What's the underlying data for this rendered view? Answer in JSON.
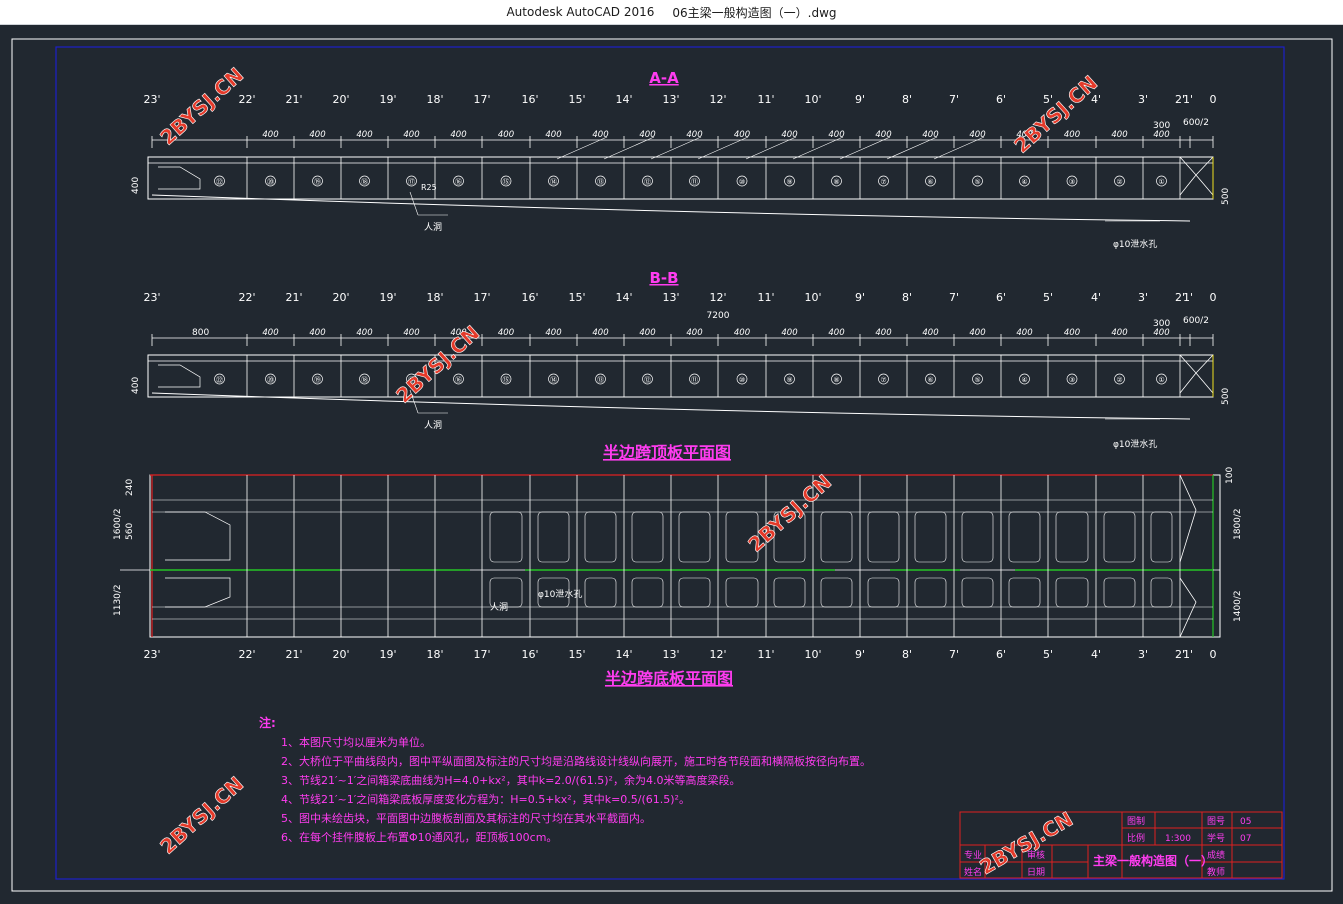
{
  "window": {
    "app": "Autodesk AutoCAD 2016",
    "file": "06主梁一般构造图（一）.dwg"
  },
  "colors": {
    "background": "#212830",
    "frame": "#ffffff",
    "inner_frame": "#1c20c8",
    "title": "#ff3cf0",
    "notes": "#ff3cf0",
    "red": "#e02020",
    "green": "#25c425",
    "yellow": "#f0e020",
    "watermark": "#e43a2a"
  },
  "drawing": {
    "section_aa": {
      "title": "A-A",
      "lbl_man": "人洞",
      "lbl_drain": "φ10泄水孔",
      "lbl_r": "R25",
      "lbl_h": "400",
      "lbl_h2": "500",
      "lbl_top": "300",
      "lbl_top2": "600/2"
    },
    "section_bb": {
      "title": "B-B",
      "lbl_total": "7200",
      "lbl_first": "800",
      "lbl_man": "人洞",
      "lbl_drain": "φ10泄水孔",
      "lbl_h": "400",
      "lbl_h2": "500",
      "lbl_top": "300",
      "lbl_top2": "600/2"
    },
    "plan_top": {
      "title": "半边跨顶板平面图"
    },
    "plan_bottom": {
      "title": "半边跨底板平面图",
      "lbl_man": "人洞",
      "lbl_drain": "φ10泄水孔",
      "dims_left": [
        "240",
        "1600/2",
        "560",
        "1130/2"
      ],
      "dims_right": [
        "100",
        "1800/2",
        "1400/2"
      ]
    },
    "nodes": [
      "23'",
      "22'",
      "21'",
      "20'",
      "19'",
      "18'",
      "17'",
      "16'",
      "15'",
      "14'",
      "13'",
      "12'",
      "11'",
      "10'",
      "9'",
      "8'",
      "7'",
      "6'",
      "5'",
      "4'",
      "3'",
      "2'",
      "1'",
      "0"
    ],
    "segment_dim": "400",
    "segment_nums": [
      "㉒",
      "⑳",
      "⑲",
      "⑱",
      "⑰",
      "⑯",
      "⑮",
      "⑭",
      "⑬",
      "⑫",
      "⑪",
      "⑩",
      "⑨",
      "⑧",
      "⑦",
      "⑥",
      "⑤",
      "④",
      "③",
      "②",
      "①",
      "⓪"
    ],
    "notes": {
      "heading": "注:",
      "items": [
        "1、本图尺寸均以厘米为单位。",
        "2、大桥位于平曲线段内，图中平纵面图及标注的尺寸均是沿路线设计线纵向展开，施工时各节段面和横隔板按径向布置。",
        "3、节线21′~1′之间箱梁底曲线为H=4.0+kx²，其中k=2.0/(61.5)²，余为4.0米等高度梁段。",
        "4、节线21′~1′之间箱梁底板厚度变化方程为：H=0.5+kx²，其中k=0.5/(61.5)²。",
        "5、图中未绘齿块，平面图中边腹板剖面及其标注的尺寸均在其水平截面内。",
        "6、在每个挂件腹板上布置Φ10通风孔，距顶板100cm。"
      ]
    },
    "title_block": {
      "fields": {
        "drawn": "图制",
        "scale": "比例",
        "scale_val": "1:300",
        "design": "专业",
        "check": "审核",
        "date": "日期",
        "name": "姓名",
        "fig_no": "图号",
        "fig_no_val": "05",
        "page": "学号",
        "page_val": "07",
        "grade": "成绩",
        "teacher": "教师"
      },
      "title": "主梁一般构造图（一）"
    },
    "watermark": "2BYSJ.CN"
  }
}
